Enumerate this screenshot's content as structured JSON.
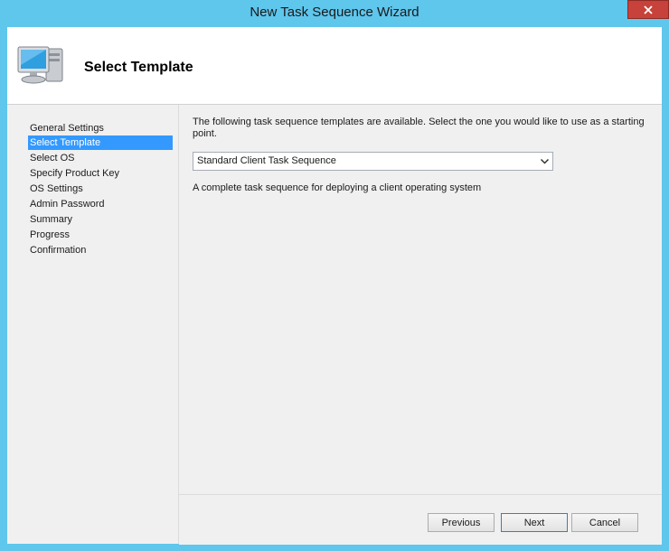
{
  "window": {
    "title": "New Task Sequence Wizard"
  },
  "header": {
    "title": "Select Template",
    "icon": "computer-icon"
  },
  "sidebar": {
    "items": [
      {
        "label": "General Settings",
        "selected": false
      },
      {
        "label": "Select Template",
        "selected": true
      },
      {
        "label": "Select OS",
        "selected": false
      },
      {
        "label": "Specify Product Key",
        "selected": false
      },
      {
        "label": "OS Settings",
        "selected": false
      },
      {
        "label": "Admin Password",
        "selected": false
      },
      {
        "label": "Summary",
        "selected": false
      },
      {
        "label": "Progress",
        "selected": false
      },
      {
        "label": "Confirmation",
        "selected": false
      }
    ]
  },
  "main": {
    "description": "The following task sequence templates are available.  Select the one you would like to use as a starting point.",
    "template_select": {
      "value": "Standard Client Task Sequence"
    },
    "template_description": "A complete task sequence for deploying a client operating system"
  },
  "buttons": {
    "previous": "Previous",
    "next": "Next",
    "cancel": "Cancel"
  },
  "colors": {
    "window_frame": "#5fc6ec",
    "close_button": "#c7423a",
    "selection": "#3399ff"
  }
}
